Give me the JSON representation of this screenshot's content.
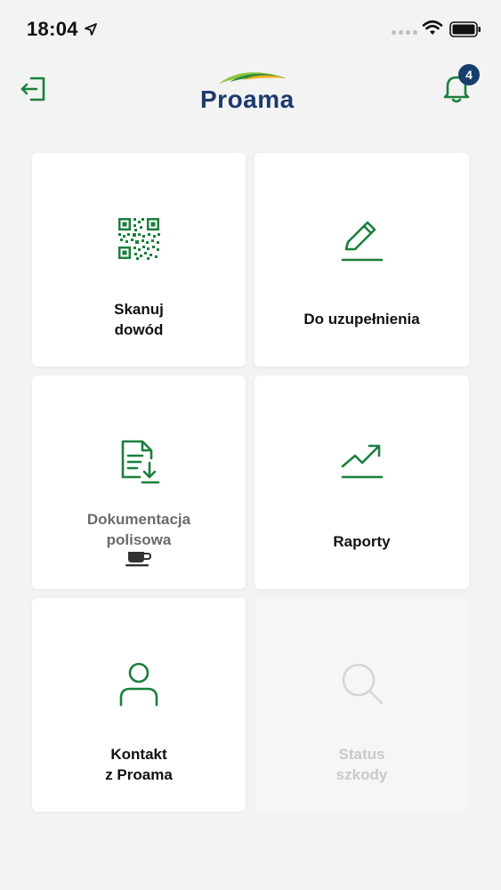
{
  "status_bar": {
    "time": "18:04"
  },
  "header": {
    "logo_text": "Proama",
    "notification_count": "4"
  },
  "colors": {
    "accent_green": "#1a7f3c",
    "brand_navy": "#1d3a6e",
    "badge_navy": "#163f6d"
  },
  "tiles": [
    {
      "label_lines": [
        "Skanuj",
        "dowód"
      ],
      "icon": "qr-code-icon",
      "enabled": true
    },
    {
      "label_lines": [
        "Do uzupełnienia"
      ],
      "icon": "pencil-icon",
      "enabled": true
    },
    {
      "label_lines": [
        "Dokumentacja",
        "polisowa"
      ],
      "icon": "document-download-icon",
      "enabled": true
    },
    {
      "label_lines": [
        "Raporty"
      ],
      "icon": "trend-chart-icon",
      "enabled": true
    },
    {
      "label_lines": [
        "Kontakt",
        "z Proama"
      ],
      "icon": "person-icon",
      "enabled": true
    },
    {
      "label_lines": [
        "Status",
        "szkody"
      ],
      "icon": "search-icon",
      "enabled": false
    }
  ]
}
